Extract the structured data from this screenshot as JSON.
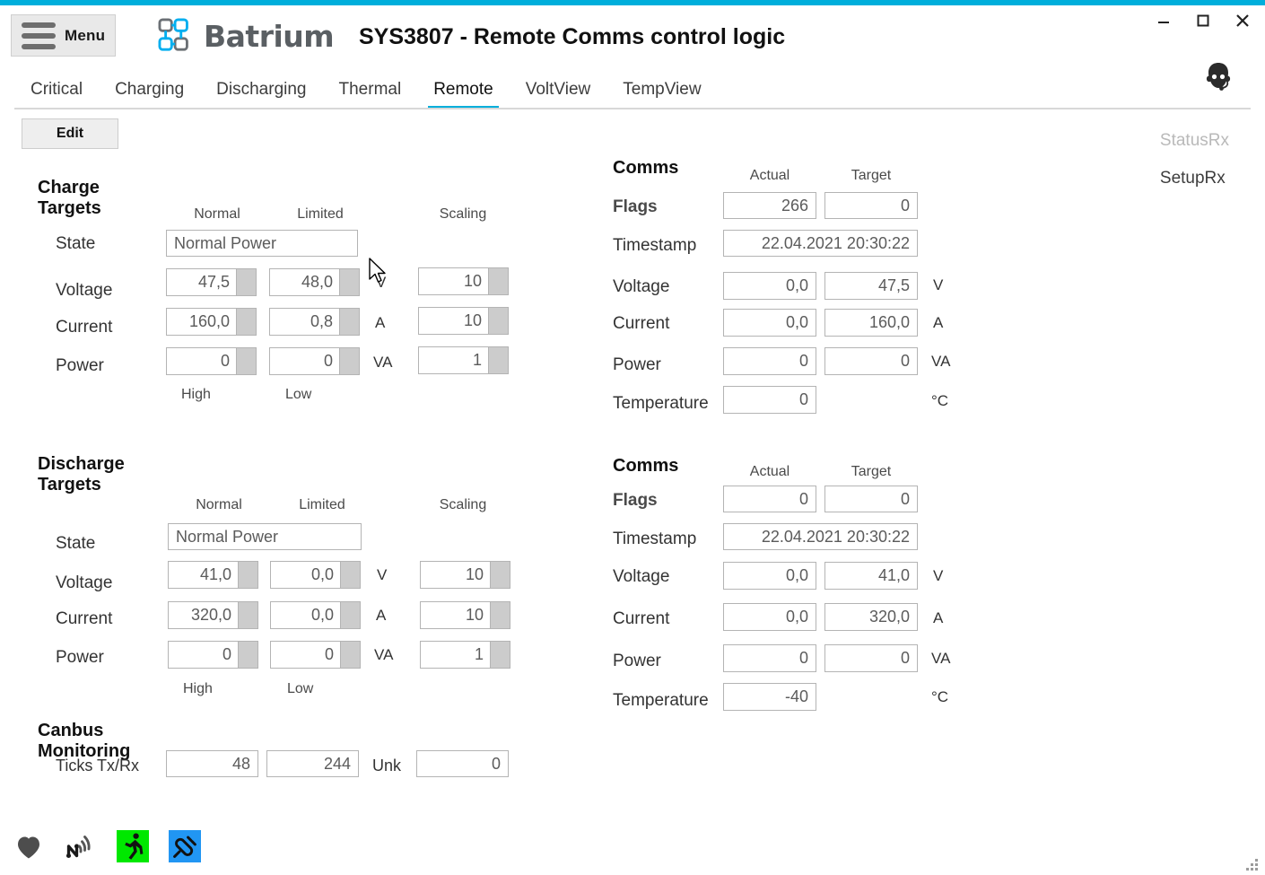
{
  "window": {
    "minimize_label": "minimize",
    "maximize_label": "maximize",
    "close_label": "close"
  },
  "header": {
    "menu_label": "Menu",
    "brand": "Batrium",
    "title": "SYS3807 - Remote Comms control logic",
    "accent_color": "#00aedb"
  },
  "tabs": [
    {
      "label": "Critical",
      "active": false
    },
    {
      "label": "Charging",
      "active": false
    },
    {
      "label": "Discharging",
      "active": false
    },
    {
      "label": "Thermal",
      "active": false
    },
    {
      "label": "Remote",
      "active": true
    },
    {
      "label": "VoltView",
      "active": false
    },
    {
      "label": "TempView",
      "active": false
    }
  ],
  "toolbar": {
    "edit_label": "Edit"
  },
  "rx_panel": {
    "status_rx": "StatusRx",
    "setup_rx": "SetupRx"
  },
  "charge_targets": {
    "title": "Charge Targets",
    "col_normal": "Normal",
    "col_limited": "Limited",
    "col_scaling": "Scaling",
    "foot_high": "High",
    "foot_low": "Low",
    "rows": {
      "state": {
        "label": "State",
        "value": "Normal Power"
      },
      "voltage": {
        "label": "Voltage",
        "normal": "47,5",
        "limited": "48,0",
        "unit": "V",
        "scaling": "10"
      },
      "current": {
        "label": "Current",
        "normal": "160,0",
        "limited": "0,8",
        "unit": "A",
        "scaling": "10"
      },
      "power": {
        "label": "Power",
        "normal": "0",
        "limited": "0",
        "unit": "VA",
        "scaling": "1"
      }
    }
  },
  "discharge_targets": {
    "title": "Discharge Targets",
    "col_normal": "Normal",
    "col_limited": "Limited",
    "col_scaling": "Scaling",
    "foot_high": "High",
    "foot_low": "Low",
    "rows": {
      "state": {
        "label": "State",
        "value": "Normal Power"
      },
      "voltage": {
        "label": "Voltage",
        "normal": "41,0",
        "limited": "0,0",
        "unit": "V",
        "scaling": "10"
      },
      "current": {
        "label": "Current",
        "normal": "320,0",
        "limited": "0,0",
        "unit": "A",
        "scaling": "10"
      },
      "power": {
        "label": "Power",
        "normal": "0",
        "limited": "0",
        "unit": "VA",
        "scaling": "1"
      }
    }
  },
  "comms_charge": {
    "title": "Comms",
    "col_actual": "Actual",
    "col_target": "Target",
    "rows": {
      "flags": {
        "label": "Flags",
        "actual": "266",
        "target": "0"
      },
      "timestamp": {
        "label": "Timestamp",
        "value": "22.04.2021 20:30:22"
      },
      "voltage": {
        "label": "Voltage",
        "actual": "0,0",
        "target": "47,5",
        "unit": "V"
      },
      "current": {
        "label": "Current",
        "actual": "0,0",
        "target": "160,0",
        "unit": "A"
      },
      "power": {
        "label": "Power",
        "actual": "0",
        "target": "0",
        "unit": "VA"
      },
      "temperature": {
        "label": "Temperature",
        "actual": "0",
        "unit": "°C"
      }
    }
  },
  "comms_discharge": {
    "title": "Comms",
    "col_actual": "Actual",
    "col_target": "Target",
    "rows": {
      "flags": {
        "label": "Flags",
        "actual": "0",
        "target": "0"
      },
      "timestamp": {
        "label": "Timestamp",
        "value": "22.04.2021 20:30:22"
      },
      "voltage": {
        "label": "Voltage",
        "actual": "0,0",
        "target": "41,0",
        "unit": "V"
      },
      "current": {
        "label": "Current",
        "actual": "0,0",
        "target": "320,0",
        "unit": "A"
      },
      "power": {
        "label": "Power",
        "actual": "0",
        "target": "0",
        "unit": "VA"
      },
      "temperature": {
        "label": "Temperature",
        "actual": "-40",
        "unit": "°C"
      }
    }
  },
  "canbus": {
    "title": "Canbus Monitoring",
    "ticks_label": "Ticks Tx/Rx",
    "ticks_tx": "48",
    "ticks_rx": "244",
    "unk_label": "Unk",
    "unk_value": "0"
  },
  "status_bar": {
    "icons": [
      {
        "name": "heart-icon",
        "color": "#4d4d4d"
      },
      {
        "name": "network-n-icon",
        "color": "#1a1a1a"
      },
      {
        "name": "running-person-icon",
        "color": "#00e800"
      },
      {
        "name": "plug-icon",
        "color": "#2196f3"
      }
    ]
  }
}
